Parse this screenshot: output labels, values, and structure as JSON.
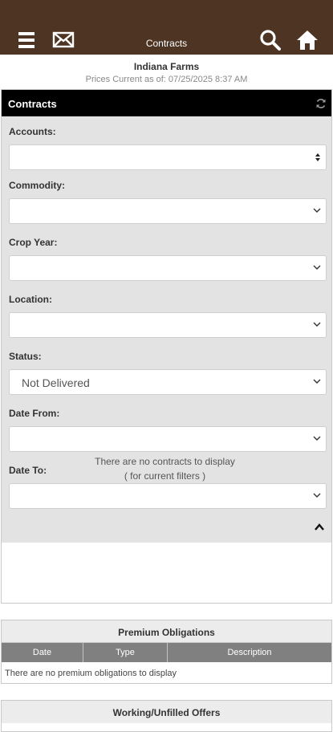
{
  "header": {
    "title": "Contracts",
    "bg_color": "#4e3422"
  },
  "company": "Indiana Farms",
  "prices_current": "Prices Current as of: 07/25/2025 8:37 AM",
  "contracts": {
    "panel_title": "Contracts",
    "filters": {
      "accounts": {
        "label": "Accounts:",
        "value": ""
      },
      "commodity": {
        "label": "Commodity:",
        "value": ""
      },
      "crop_year": {
        "label": "Crop Year:",
        "value": ""
      },
      "location": {
        "label": "Location:",
        "value": ""
      },
      "status": {
        "label": "Status:",
        "value": "Not Delivered"
      },
      "date_from": {
        "label": "Date From:",
        "value": ""
      },
      "date_to": {
        "label": "Date To:",
        "value": ""
      }
    },
    "empty_line1": "There are no contracts to display",
    "empty_line2": "( for current filters )"
  },
  "premium": {
    "title": "Premium Obligations",
    "columns": [
      "Date",
      "Type",
      "Description"
    ],
    "empty": "There are no premium obligations to display"
  },
  "offers": {
    "title": "Working/Unfilled Offers"
  }
}
